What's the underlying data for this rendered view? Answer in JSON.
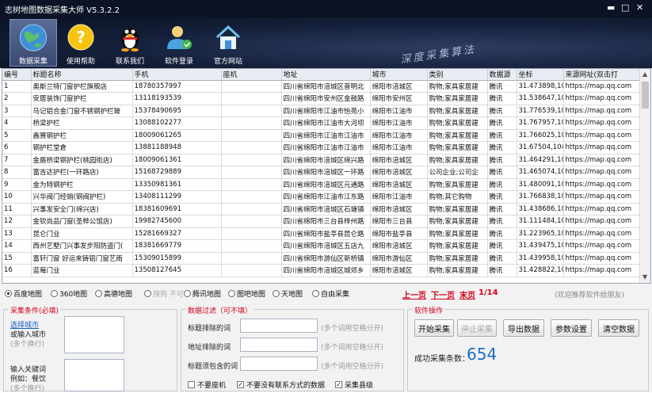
{
  "app": {
    "title": "志树地图数据采集大师 V5.3.2.2"
  },
  "toolbar": {
    "items": [
      {
        "label": "数据采集",
        "icon": "globe-icon"
      },
      {
        "label": "使用帮助",
        "icon": "help-icon"
      },
      {
        "label": "联系我们",
        "icon": "qq-penguin-icon"
      },
      {
        "label": "软件登录",
        "icon": "user-login-icon"
      },
      {
        "label": "官方网站",
        "icon": "home-icon"
      }
    ],
    "watermark": "深度采集算法"
  },
  "table": {
    "columns": [
      "编号",
      "标题名称",
      "手机",
      "座机",
      "地址",
      "城市",
      "类别",
      "数据源",
      "坐标",
      "来源网址(双击打"
    ],
    "rows": [
      [
        "1",
        "奥斯兰特门窗护栏旗舰店",
        "18780357997",
        "",
        "四川省绵阳市涪城区普明北",
        "绵阳市涪城区",
        "购物;家具家居建",
        "腾讯",
        "31.473898,104",
        "https://map.qq.com"
      ],
      [
        "2",
        "安居装饰门窗护栏",
        "13118193539",
        "",
        "四川省绵阳市安州区金鼓路",
        "绵阳市安州区",
        "购物;家具家居建",
        "腾讯",
        "31.538647,104",
        "https://map.qq.com"
      ],
      [
        "3",
        "马记铝合金门窗不锈钢护栏玻",
        "15378490695",
        "",
        "四川省绵阳市江油市怡苑小",
        "绵阳市江油市",
        "购物;家具家居建",
        "腾讯",
        "31.776539,104",
        "https://map.qq.com"
      ],
      [
        "4",
        "桥梁护栏",
        "13088102277",
        "",
        "四川省绵阳市江油市大河坝",
        "绵阳市江油市",
        "购物;家具家居建",
        "腾讯",
        "31.767957,104",
        "https://map.qq.com"
      ],
      [
        "5",
        "鑫赛钢护栏",
        "18009061265",
        "",
        "四川省绵阳市江油市江油市",
        "绵阳市江油市",
        "购物;家具家居建",
        "腾讯",
        "31.766025,104",
        "https://map.qq.com"
      ],
      [
        "6",
        "钢护栏堂倉",
        "13881188948",
        "",
        "四川省绵阳市江油市江油市",
        "绵阳市江油市",
        "购物;家具家居建",
        "腾讯",
        "31.67504,104.",
        "https://map.qq.com"
      ],
      [
        "7",
        "金盾桥梁钢护栏(桃园街店)",
        "18009061361",
        "",
        "四川省绵阳市涪城区绵兴路",
        "绵阳市涪城区",
        "购物;家具家居建",
        "腾讯",
        "31.464291,104",
        "https://map.qq.com"
      ],
      [
        "8",
        "富吉达护栏(一环路店)",
        "15168729889",
        "",
        "四川省绵阳市涪城区一环路",
        "绵阳市涪城区",
        "公司企业;公司企",
        "腾讯",
        "31.465074,104",
        "https://map.qq.com"
      ],
      [
        "9",
        "金为特钢护栏",
        "13350981361",
        "",
        "四川省绵阳市涪城区元通路",
        "绵阳市涪城区",
        "购物;家具家居建",
        "腾讯",
        "31.480091,104",
        "https://map.qq.com"
      ],
      [
        "10",
        "兴华阀门经销(钢阀护栏)",
        "13408111299",
        "",
        "四川省绵阳市江油市江东路",
        "绵阳市江油市",
        "购物;其它购物",
        "腾讯",
        "31.766838,104",
        "https://map.qq.com"
      ],
      [
        "11",
        "兴事发安全门(绵兴店)",
        "18381609691",
        "",
        "四川省绵阳市涪城区石塘镇",
        "绵阳市涪城区",
        "购物;家具家居建",
        "腾讯",
        "31.438686,104",
        "https://map.qq.com"
      ],
      [
        "12",
        "金钦尚品门窗(圣桦公馆店)",
        "19982745600",
        "",
        "四川省绵阳市三台县梓州路",
        "绵阳市三台县",
        "购物;家具家居建",
        "腾讯",
        "31.111484,105",
        "https://map.qq.com"
      ],
      [
        "13",
        "昆仑门业",
        "15281669327",
        "",
        "四川省绵阳市盐亭县昆仑路",
        "绵阳市盐亭县",
        "购物;家具家居建",
        "腾讯",
        "31.223965,105",
        "https://map.qq.com"
      ],
      [
        "14",
        "西州艺墅门兴事发步阳防盗门(",
        "18381669779",
        "",
        "四川省绵阳市涪城区五店九",
        "绵阳市涪城区",
        "购物;家具家居建",
        "腾讯",
        "31.439475,104",
        "https://map.qq.com"
      ],
      [
        "15",
        "富轩门窗 好运来铸铝门窗艺雨",
        "15309015899",
        "",
        "四川省绵阳市游仙区新桥镇",
        "绵阳市游仙区",
        "购物;家具家居建",
        "腾讯",
        "31.439958,104",
        "https://map.qq.com"
      ],
      [
        "16",
        "蓝莓门业",
        "13508127645",
        "",
        "四川省绵阳市涪城区城郊乡",
        "绵阳市涪城区",
        "购物;家具家居建",
        "腾讯",
        "31.428822,104",
        "https://map.qq.com"
      ]
    ]
  },
  "sources": {
    "options": [
      {
        "label": "百度地图",
        "checked": true,
        "enabled": true
      },
      {
        "label": "360地图",
        "checked": false,
        "enabled": true
      },
      {
        "label": "高德地图",
        "checked": false,
        "enabled": true
      },
      {
        "label": "搜狗 不可",
        "checked": false,
        "enabled": false
      },
      {
        "label": "腾讯地图",
        "checked": false,
        "enabled": true
      },
      {
        "label": "图吧地图",
        "checked": false,
        "enabled": true
      },
      {
        "label": "天地图",
        "checked": false,
        "enabled": true
      },
      {
        "label": "自由采集",
        "checked": false,
        "enabled": true
      }
    ]
  },
  "pager": {
    "prev": "上一页",
    "next": "下一页",
    "last": "末页",
    "page": "1/14",
    "recommend": "(欢迎推荐软件给朋友)"
  },
  "conditions": {
    "title": "采集条件(必填)",
    "select_city": "选择城市",
    "or_input_city": "或输入城市",
    "multi_line1": "(多个换行)",
    "keyword_label": "输入关键词",
    "keyword_example": "例如：餐饮",
    "multi_line2": "(多个换行)"
  },
  "filter": {
    "title": "数据过滤（可不填）",
    "title_exclude": "标题排除的词",
    "addr_exclude": "地址排除的词",
    "title_include": "标题须包含的词",
    "hint": "(多个词用空格分开)",
    "chk_no_landline": "不要座机",
    "chk_no_contact": "不要没有联系方式的数据",
    "chk_county": "采集县级"
  },
  "ops": {
    "title": "软件操作",
    "start": "开始采集",
    "stop": "停止采集",
    "export": "导出数据",
    "settings": "参数设置",
    "clear": "清空数据",
    "count_label": "成功采集条数：",
    "count": "654"
  }
}
